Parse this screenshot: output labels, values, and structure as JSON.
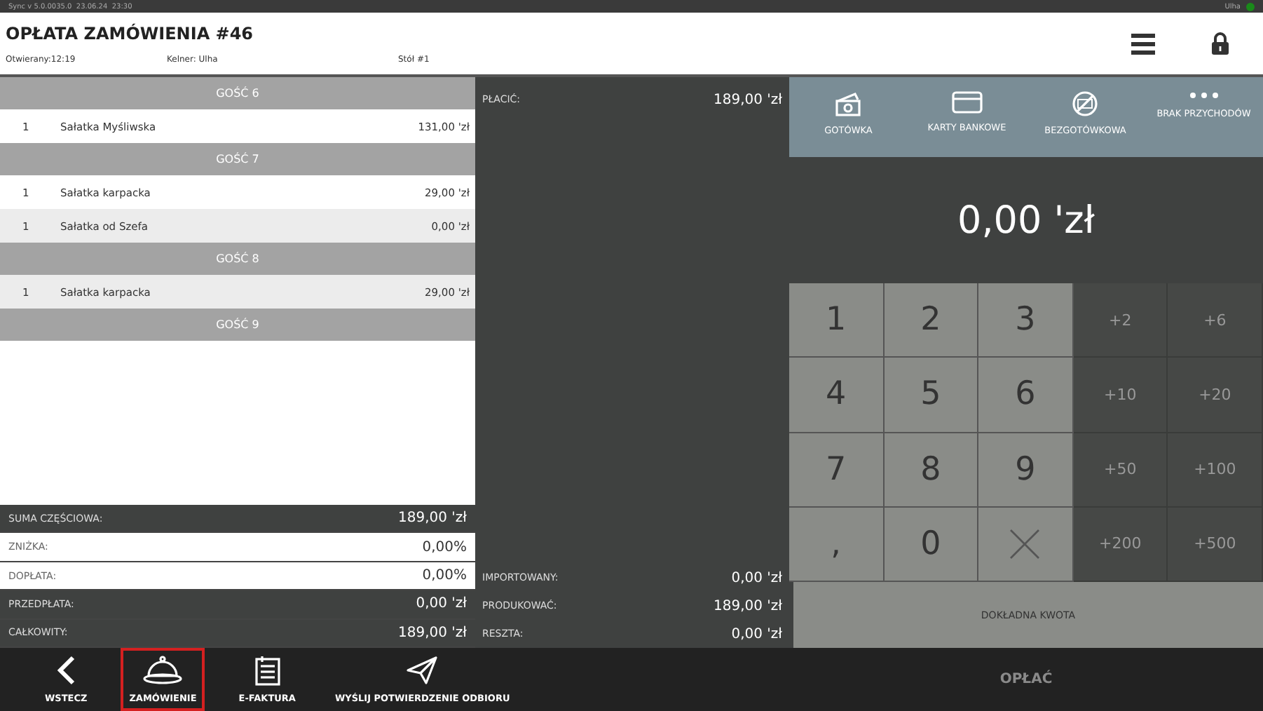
{
  "status_bar": {
    "left": "Sync v 5.0.0035.0  23.06.24  23:30",
    "right": "Ulha"
  },
  "header": {
    "title": "OPŁATA ZAMÓWIENIA #46",
    "opened": "Otwierany:12:19",
    "waiter": "Kelner: Ulha",
    "table": "Stół #1"
  },
  "guests": [
    {
      "name": "GOŚĆ 6",
      "items": [
        {
          "qty": "1",
          "name": "Sałatka Myśliwska",
          "price": "131,00 'zł",
          "highlighted": false
        }
      ]
    },
    {
      "name": "GOŚĆ 7",
      "items": [
        {
          "qty": "1",
          "name": "Sałatka karpacka",
          "price": "29,00 'zł",
          "highlighted": false
        },
        {
          "qty": "1",
          "name": "Sałatka od Szefa",
          "price": "0,00 'zł",
          "highlighted": true
        }
      ]
    },
    {
      "name": "GOŚĆ 8",
      "items": [
        {
          "qty": "1",
          "name": "Sałatka karpacka",
          "price": "29,00 'zł",
          "highlighted": true
        }
      ]
    },
    {
      "name": "GOŚĆ 9"
    }
  ],
  "totals": [
    {
      "label": "SUMA CZĘŚCIOWA:",
      "value": "189,00 'zł",
      "kind": "dark"
    },
    {
      "label": "ZNIŻKA:",
      "value": "0,00%",
      "kind": "light"
    },
    {
      "label": "DOPŁATA:",
      "value": "0,00%",
      "kind": "light"
    },
    {
      "label": "PRZEDPŁATA:",
      "value": "0,00 'zł",
      "kind": "dark"
    },
    {
      "label": "CAŁKOWITY:",
      "value": "189,00 'zł",
      "kind": "dark"
    }
  ],
  "summary": {
    "pay": {
      "label": "PŁACIĆ:",
      "value": "189,00 'zł"
    },
    "rows": [
      {
        "label": "IMPORTOWANY:",
        "value": "0,00 'zł"
      },
      {
        "label": "PRODUKOWAĆ:",
        "value": "189,00 'zł"
      },
      {
        "label": "RESZTA:",
        "value": "0,00 'zł"
      }
    ]
  },
  "payment_methods": [
    {
      "kind": "cash",
      "label": "GOTÓWKA"
    },
    {
      "kind": "card",
      "label": "KARTY BANKOWE"
    },
    {
      "kind": "noncash",
      "label": "BEZGOTÓWKOWA"
    },
    {
      "kind": "more",
      "label": "BRAK PRZYCHODÓW"
    }
  ],
  "amount": "0,00 'zł",
  "keypad": [
    {
      "kind": "digit",
      "label": "1"
    },
    {
      "kind": "digit",
      "label": "2"
    },
    {
      "kind": "digit",
      "label": "3"
    },
    {
      "kind": "add",
      "label": "+2"
    },
    {
      "kind": "add",
      "label": "+6"
    },
    {
      "kind": "digit",
      "label": "4"
    },
    {
      "kind": "digit",
      "label": "5"
    },
    {
      "kind": "digit",
      "label": "6"
    },
    {
      "kind": "add",
      "label": "+10"
    },
    {
      "kind": "add",
      "label": "+20"
    },
    {
      "kind": "digit",
      "label": "7"
    },
    {
      "kind": "digit",
      "label": "8"
    },
    {
      "kind": "digit",
      "label": "9"
    },
    {
      "kind": "add",
      "label": "+50"
    },
    {
      "kind": "add",
      "label": "+100"
    },
    {
      "kind": "digit",
      "label": ","
    },
    {
      "kind": "digit",
      "label": "0"
    },
    {
      "kind": "clear"
    },
    {
      "kind": "add",
      "label": "+200"
    },
    {
      "kind": "add",
      "label": "+500"
    }
  ],
  "exact_button": "DOKŁADNA KWOTA",
  "toolbar": [
    {
      "kind": "back",
      "label": "WSTECZ",
      "selected": false
    },
    {
      "kind": "order",
      "label": "ZAMÓWIENIE",
      "selected": true
    },
    {
      "kind": "invoice",
      "label": "E-FAKTURA",
      "selected": false
    },
    {
      "kind": "send",
      "label": "WYŚLIJ POTWIERDZENIE ODBIORU",
      "selected": false
    }
  ],
  "pay_button": "OPŁAĆ"
}
